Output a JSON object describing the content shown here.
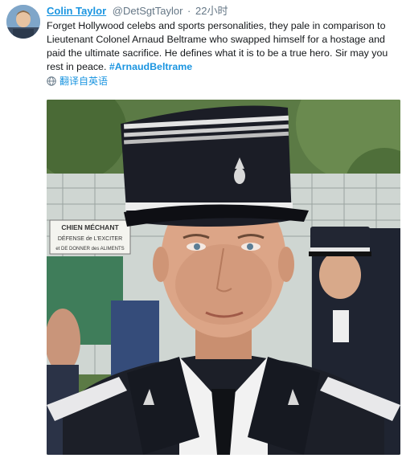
{
  "author": {
    "display_name": "Colin Taylor",
    "handle": "@DetSgtTaylor",
    "separator": "·",
    "time": "22小时"
  },
  "tweet": {
    "text": "Forget Hollywood celebs and sports personalities, they pale in comparison to Lieutenant Colonel Arnaud Beltrame who swapped himself for a hostage and paid the ultimate sacrifice. He defines what it is to be a true hero. Sir may you rest in peace. ",
    "hashtag": "#ArnaudBeltrame"
  },
  "translate": {
    "label": "翻译自英语",
    "icon": "globe-icon"
  },
  "photo": {
    "sign_lines": [
      "CHIEN MÉCHANT",
      "DÉFENSE de L'EXCITER",
      "et DE DONNER des ALIMENTS"
    ]
  },
  "colors": {
    "link": "#1b95e0",
    "muted": "#657786",
    "text": "#14171a"
  }
}
